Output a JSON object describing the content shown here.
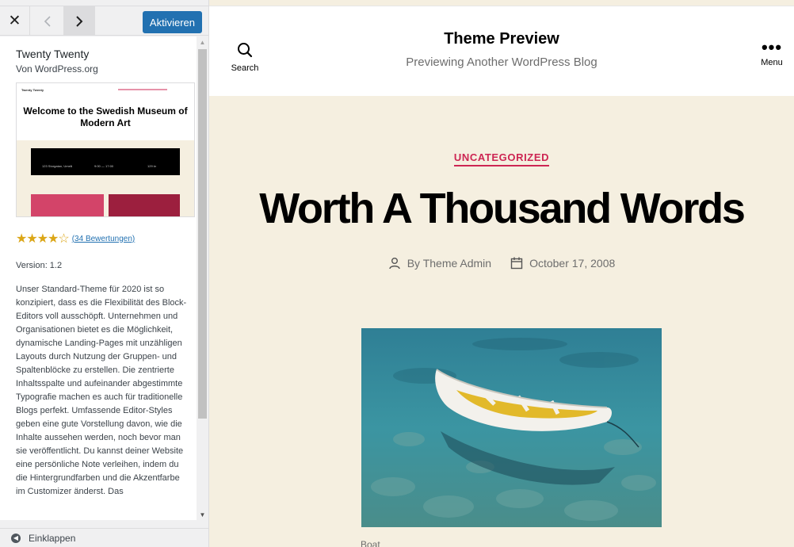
{
  "topbar": {
    "close_icon": "close-icon",
    "prev_icon": "chevron-left-icon",
    "next_icon": "chevron-right-icon",
    "activate_label": "Aktivieren"
  },
  "theme": {
    "name": "Twenty Twenty",
    "author": "Von WordPress.org",
    "screenshot": {
      "logo": "Twenty Twenty",
      "title": "Welcome to the Swedish Museum of Modern Art",
      "address": "123 Storgatan, Umeå",
      "hours": "9:00 — 17:00",
      "price": "129 kr"
    },
    "rating_stars": 4,
    "rating_max": 5,
    "rating_count": "(34 Bewertungen)",
    "version": "Version: 1.2",
    "description": "Unser Standard-Theme für 2020 ist so konzipiert, dass es die Flexibilität des Block-Editors voll ausschöpft. Unternehmen und Organisationen bietet es die Möglichkeit, dynamische Landing-Pages mit unzähligen Layouts durch Nutzung der Gruppen- und Spaltenblöcke zu erstellen. Die zentrierte Inhaltsspalte und aufeinander abgestimmte Typografie machen es auch für traditionelle Blogs perfekt. Umfassende Editor-Styles geben eine gute Vorstellung davon, wie die Inhalte aussehen werden, noch bevor man sie veröffentlicht. Du kannst deiner Website eine persönliche Note verleihen, indem du die Hintergrundfarben und die Akzentfarbe im Customizer änderst. Das"
  },
  "footer": {
    "collapse_label": "Einklappen"
  },
  "preview": {
    "search_label": "Search",
    "menu_label": "Menu",
    "site_title": "Theme Preview",
    "site_description": "Previewing Another WordPress Blog",
    "category": "UNCATEGORIZED",
    "post_title": "Worth A Thousand Words",
    "author": "By Theme Admin",
    "date": "October 17, 2008",
    "caption": "Boat"
  },
  "colors": {
    "accent": "#cd2653",
    "button": "#2271b1",
    "preview_bg": "#f5efe0",
    "stars": "#dba617"
  }
}
